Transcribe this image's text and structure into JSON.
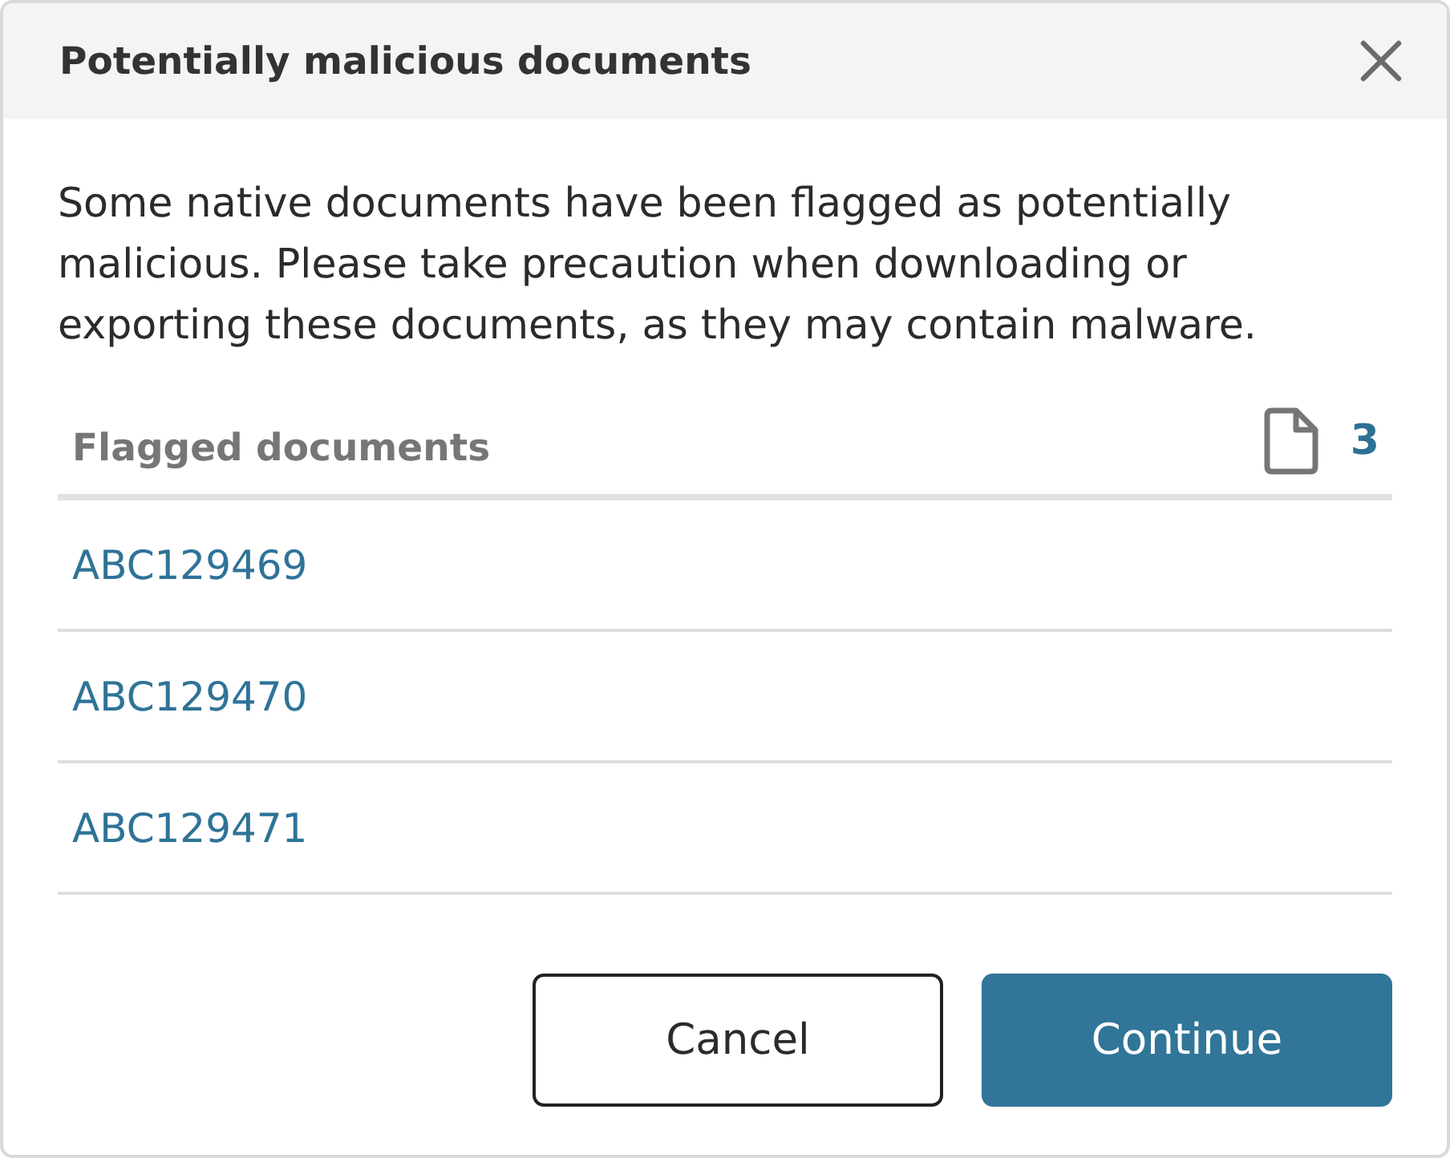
{
  "window": {
    "title": "Potentially malicious documents"
  },
  "message": "Some native documents have been flagged as potentially malicious. Please take precaution when downloading or exporting these documents, as they may contain malware.",
  "flagged_list": {
    "heading": "Flagged documents",
    "count": "3",
    "items": [
      {
        "label": "ABC129469"
      },
      {
        "label": "ABC129470"
      },
      {
        "label": "ABC129471"
      }
    ]
  },
  "buttons": [
    {
      "label": "Cancel",
      "kind": "secondary"
    },
    {
      "label": "Continue",
      "kind": "primary"
    }
  ]
}
